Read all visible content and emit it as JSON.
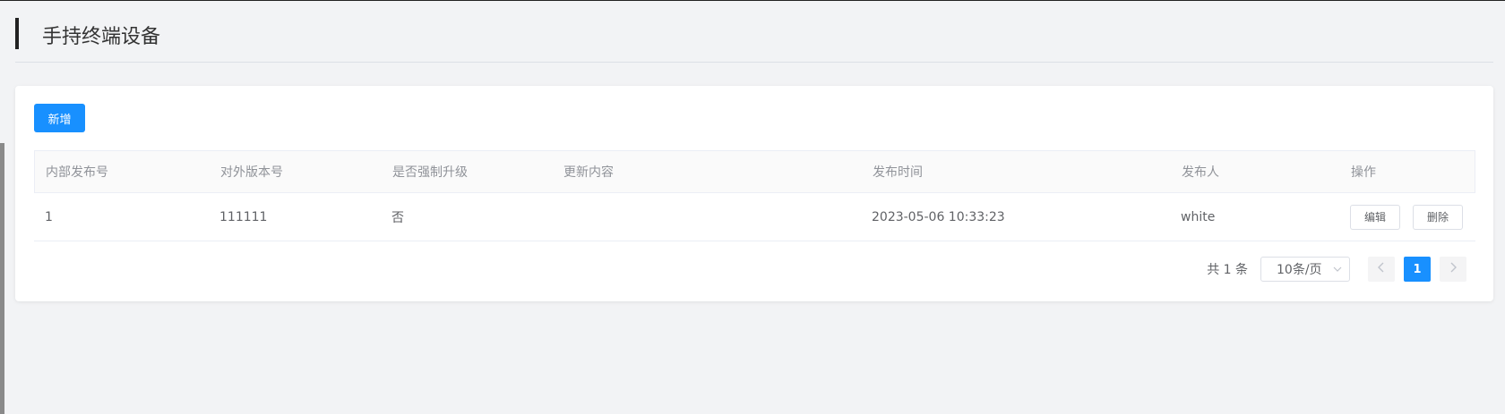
{
  "page": {
    "title": "手持终端设备"
  },
  "toolbar": {
    "add_label": "新增"
  },
  "table": {
    "columns": [
      "内部发布号",
      "对外版本号",
      "是否强制升级",
      "更新内容",
      "发布时间",
      "发布人",
      "操作"
    ],
    "rows": [
      {
        "internal_release": "1",
        "external_version": "111111",
        "force_upgrade": "否",
        "update_content": "",
        "release_time": "2023-05-06 10:33:23",
        "publisher": "white",
        "edit_label": "编辑",
        "delete_label": "删除"
      }
    ]
  },
  "pagination": {
    "total_text": "共 1 条",
    "page_size": "10条/页",
    "current_page": "1"
  },
  "colors": {
    "primary": "#1890ff"
  },
  "icons": {
    "prev": "chevron-left-icon",
    "next": "chevron-right-icon",
    "dropdown": "chevron-down-icon"
  }
}
